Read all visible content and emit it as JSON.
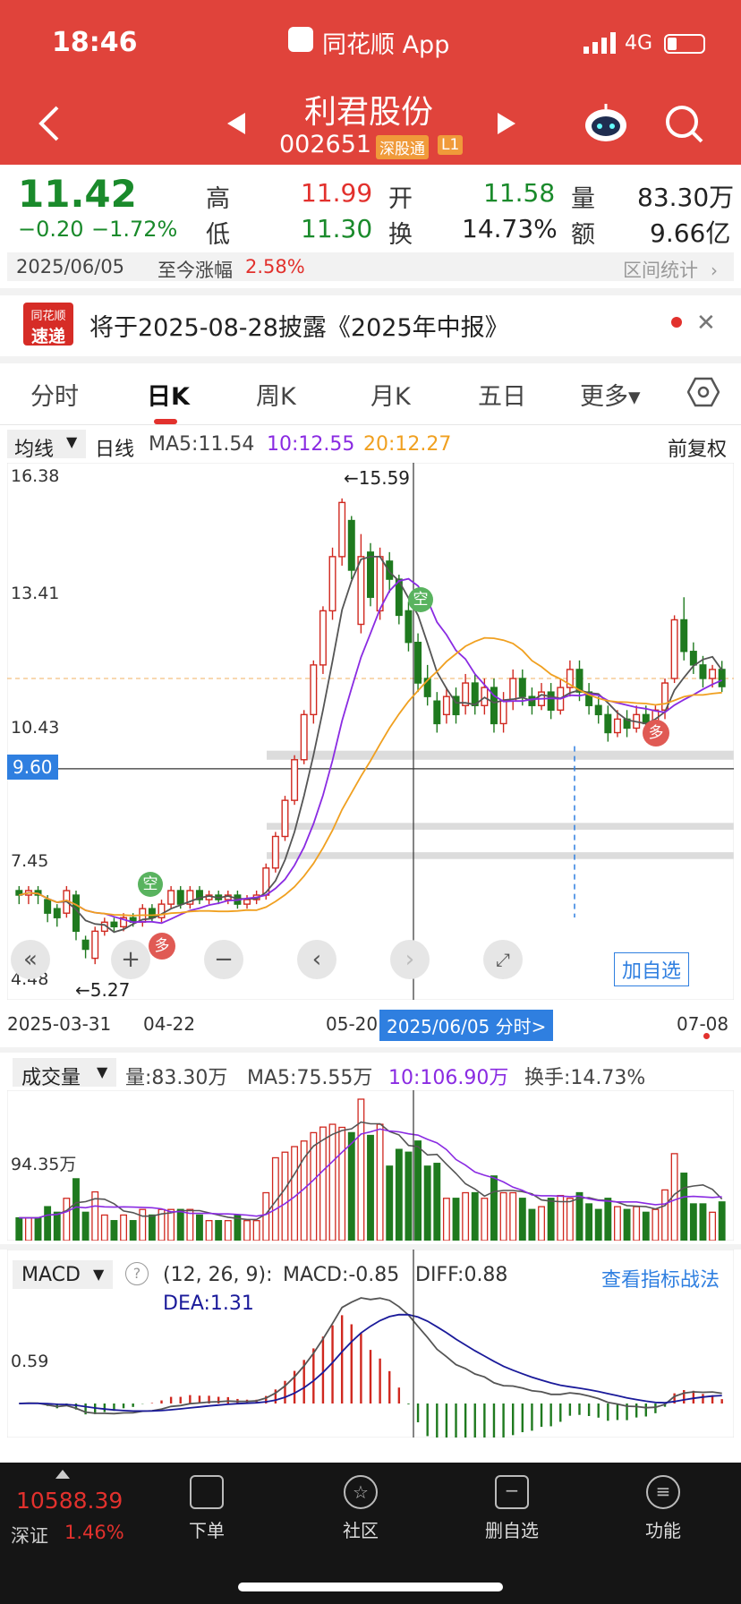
{
  "status": {
    "time": "18:46",
    "app": "同花顺 App",
    "network": "4G"
  },
  "header": {
    "name": "利君股份",
    "code": "002651",
    "badge1": "深股通",
    "badge2": "L1"
  },
  "quote": {
    "price": "11.42",
    "change": "−0.20",
    "change_pct": "−1.72%",
    "high_label": "高",
    "high": "11.99",
    "low_label": "低",
    "low": "11.30",
    "open_label": "开",
    "open": "11.58",
    "turnover_label": "换",
    "turnover": "14.73%",
    "volume_label": "量",
    "volume": "83.30万",
    "amount_label": "额",
    "amount": "9.66亿",
    "date": "2025/06/05",
    "since_label": "至今涨幅",
    "since_value": "2.58%",
    "range_stat": "区间统计"
  },
  "notice": {
    "logo_top": "同花顺",
    "logo_bottom": "速递",
    "text": "将于2025-08-28披露《2025年中报》"
  },
  "tabs": [
    {
      "label": "分时"
    },
    {
      "label": "日K"
    },
    {
      "label": "周K"
    },
    {
      "label": "月K"
    },
    {
      "label": "五日"
    },
    {
      "label": "更多▾"
    }
  ],
  "kline": {
    "ma_select": "均线",
    "period": "日线",
    "ma5": "MA5:11.54",
    "ma10": "10:12.55",
    "ma20": "20:12.27",
    "adjust": "前复权",
    "y_labels": [
      "16.38",
      "13.41",
      "10.43",
      "7.45",
      "4.48"
    ],
    "cursor_price": "9.60",
    "high_mark": "←15.59",
    "low_mark": "←5.27",
    "x_labels": [
      "2025-03-31",
      "04-22",
      "05-20",
      "07-08"
    ],
    "cursor_date": "2025/06/05 分时>",
    "add_fav": "加自选",
    "sig_kong": "空",
    "sig_duo": "多"
  },
  "volume": {
    "select": "成交量",
    "vol": "量:83.30万",
    "ma5": "MA5:75.55万",
    "ma10": "10:106.90万",
    "turnover": "换手:14.73%",
    "y_label": "94.35万"
  },
  "macd": {
    "select": "MACD",
    "params": "(12, 26, 9):",
    "macd": "MACD:-0.85",
    "diff": "DIFF:0.88",
    "dea": "DEA:1.31",
    "link": "查看指标战法",
    "y_label": "0.59"
  },
  "bottom": {
    "index_value": "10588.39",
    "index_name": "深证",
    "index_pct": "1.46%",
    "items": [
      {
        "label": "下单"
      },
      {
        "label": "社区"
      },
      {
        "label": "删自选"
      },
      {
        "label": "功能"
      }
    ]
  },
  "colors": {
    "brand": "#e0433b",
    "up": "#d0281f",
    "down": "#1f7a1f",
    "ma5": "#555555",
    "ma10": "#8a2be2",
    "ma20": "#f0a020",
    "accent": "#2f7fe0"
  },
  "chart_data": {
    "type": "candlestick",
    "ylim": [
      4.48,
      16.38
    ],
    "candles": [
      {
        "o": 6.9,
        "c": 6.8,
        "h": 7.0,
        "l": 6.6
      },
      {
        "o": 6.8,
        "c": 6.9,
        "h": 7.0,
        "l": 6.6
      },
      {
        "o": 6.9,
        "c": 6.8,
        "h": 7.0,
        "l": 6.6
      },
      {
        "o": 6.7,
        "c": 6.4,
        "h": 6.8,
        "l": 6.2
      },
      {
        "o": 6.5,
        "c": 6.3,
        "h": 6.6,
        "l": 6.1
      },
      {
        "o": 6.4,
        "c": 6.9,
        "h": 7.0,
        "l": 6.3
      },
      {
        "o": 6.8,
        "c": 6.0,
        "h": 6.9,
        "l": 5.8
      },
      {
        "o": 5.8,
        "c": 5.6,
        "h": 5.9,
        "l": 5.4
      },
      {
        "o": 5.4,
        "c": 6.0,
        "h": 6.1,
        "l": 5.27
      },
      {
        "o": 6.0,
        "c": 6.2,
        "h": 6.3,
        "l": 5.9
      },
      {
        "o": 6.2,
        "c": 6.1,
        "h": 6.3,
        "l": 6.0
      },
      {
        "o": 6.1,
        "c": 6.3,
        "h": 6.4,
        "l": 6.0
      },
      {
        "o": 6.3,
        "c": 6.2,
        "h": 6.4,
        "l": 6.1
      },
      {
        "o": 6.2,
        "c": 6.5,
        "h": 6.6,
        "l": 6.1
      },
      {
        "o": 6.5,
        "c": 6.3,
        "h": 6.6,
        "l": 6.2
      },
      {
        "o": 6.3,
        "c": 6.6,
        "h": 6.7,
        "l": 6.2
      },
      {
        "o": 6.6,
        "c": 6.9,
        "h": 7.0,
        "l": 6.5
      },
      {
        "o": 6.9,
        "c": 6.6,
        "h": 7.0,
        "l": 6.5
      },
      {
        "o": 6.6,
        "c": 6.9,
        "h": 7.0,
        "l": 6.5
      },
      {
        "o": 6.9,
        "c": 6.7,
        "h": 7.0,
        "l": 6.6
      },
      {
        "o": 6.7,
        "c": 6.8,
        "h": 6.9,
        "l": 6.6
      },
      {
        "o": 6.8,
        "c": 6.7,
        "h": 6.9,
        "l": 6.6
      },
      {
        "o": 6.7,
        "c": 6.8,
        "h": 6.9,
        "l": 6.6
      },
      {
        "o": 6.8,
        "c": 6.6,
        "h": 6.9,
        "l": 6.5
      },
      {
        "o": 6.6,
        "c": 6.7,
        "h": 6.8,
        "l": 6.5
      },
      {
        "o": 6.7,
        "c": 6.8,
        "h": 6.9,
        "l": 6.6
      },
      {
        "o": 6.8,
        "c": 7.4,
        "h": 7.5,
        "l": 6.7
      },
      {
        "o": 7.4,
        "c": 8.1,
        "h": 8.2,
        "l": 7.3
      },
      {
        "o": 8.1,
        "c": 8.9,
        "h": 9.0,
        "l": 8.0
      },
      {
        "o": 8.9,
        "c": 9.8,
        "h": 9.9,
        "l": 8.8
      },
      {
        "o": 9.8,
        "c": 10.8,
        "h": 10.9,
        "l": 9.7
      },
      {
        "o": 10.8,
        "c": 11.9,
        "h": 12.0,
        "l": 10.6
      },
      {
        "o": 11.9,
        "c": 13.1,
        "h": 13.2,
        "l": 11.7
      },
      {
        "o": 13.1,
        "c": 14.3,
        "h": 14.5,
        "l": 12.9
      },
      {
        "o": 14.3,
        "c": 15.5,
        "h": 15.59,
        "l": 14.1
      },
      {
        "o": 15.1,
        "c": 14.0,
        "h": 15.2,
        "l": 13.8
      },
      {
        "o": 12.8,
        "c": 14.3,
        "h": 14.8,
        "l": 12.6
      },
      {
        "o": 14.4,
        "c": 13.4,
        "h": 14.6,
        "l": 13.2
      },
      {
        "o": 13.1,
        "c": 14.3,
        "h": 14.5,
        "l": 12.9
      },
      {
        "o": 14.2,
        "c": 13.8,
        "h": 14.4,
        "l": 13.5
      },
      {
        "o": 13.8,
        "c": 13.0,
        "h": 13.9,
        "l": 12.8
      },
      {
        "o": 13.1,
        "c": 12.4,
        "h": 13.3,
        "l": 12.2
      },
      {
        "o": 12.4,
        "c": 11.5,
        "h": 12.6,
        "l": 11.3
      },
      {
        "o": 11.6,
        "c": 11.2,
        "h": 11.9,
        "l": 11.0
      },
      {
        "o": 11.1,
        "c": 10.6,
        "h": 11.3,
        "l": 10.4
      },
      {
        "o": 10.8,
        "c": 11.2,
        "h": 11.4,
        "l": 10.6
      },
      {
        "o": 11.2,
        "c": 10.8,
        "h": 11.4,
        "l": 10.6
      },
      {
        "o": 11.0,
        "c": 11.5,
        "h": 11.7,
        "l": 10.8
      },
      {
        "o": 11.5,
        "c": 11.0,
        "h": 11.7,
        "l": 10.8
      },
      {
        "o": 11.0,
        "c": 11.4,
        "h": 11.6,
        "l": 10.8
      },
      {
        "o": 11.4,
        "c": 10.6,
        "h": 11.6,
        "l": 10.4
      },
      {
        "o": 10.6,
        "c": 11.1,
        "h": 11.3,
        "l": 10.4
      },
      {
        "o": 11.1,
        "c": 11.6,
        "h": 11.8,
        "l": 10.9
      },
      {
        "o": 11.6,
        "c": 11.2,
        "h": 11.8,
        "l": 11.0
      },
      {
        "o": 11.2,
        "c": 11.0,
        "h": 11.4,
        "l": 10.8
      },
      {
        "o": 11.0,
        "c": 11.3,
        "h": 11.5,
        "l": 10.9
      },
      {
        "o": 11.3,
        "c": 10.9,
        "h": 11.5,
        "l": 10.7
      },
      {
        "o": 10.9,
        "c": 11.4,
        "h": 11.6,
        "l": 10.8
      },
      {
        "o": 11.4,
        "c": 11.8,
        "h": 12.0,
        "l": 11.2
      },
      {
        "o": 11.8,
        "c": 11.3,
        "h": 12.0,
        "l": 11.1
      },
      {
        "o": 11.3,
        "c": 11.0,
        "h": 11.5,
        "l": 10.8
      },
      {
        "o": 11.0,
        "c": 10.8,
        "h": 11.2,
        "l": 10.6
      },
      {
        "o": 10.8,
        "c": 10.4,
        "h": 11.0,
        "l": 10.2
      },
      {
        "o": 10.4,
        "c": 10.7,
        "h": 10.9,
        "l": 10.3
      },
      {
        "o": 10.7,
        "c": 10.5,
        "h": 10.9,
        "l": 10.3
      },
      {
        "o": 10.5,
        "c": 10.8,
        "h": 11.0,
        "l": 10.4
      },
      {
        "o": 10.8,
        "c": 10.6,
        "h": 11.0,
        "l": 10.5
      },
      {
        "o": 10.6,
        "c": 10.9,
        "h": 11.0,
        "l": 10.5
      },
      {
        "o": 10.9,
        "c": 11.5,
        "h": 11.6,
        "l": 10.7
      },
      {
        "o": 11.6,
        "c": 12.9,
        "h": 13.0,
        "l": 11.5
      },
      {
        "o": 12.9,
        "c": 12.2,
        "h": 13.4,
        "l": 12.0
      },
      {
        "o": 12.2,
        "c": 11.9,
        "h": 12.4,
        "l": 11.7
      },
      {
        "o": 11.9,
        "c": 11.6,
        "h": 12.1,
        "l": 11.4
      },
      {
        "o": 11.6,
        "c": 11.8,
        "h": 11.9,
        "l": 11.4
      },
      {
        "o": 11.8,
        "c": 11.42,
        "h": 11.99,
        "l": 11.3
      }
    ]
  }
}
